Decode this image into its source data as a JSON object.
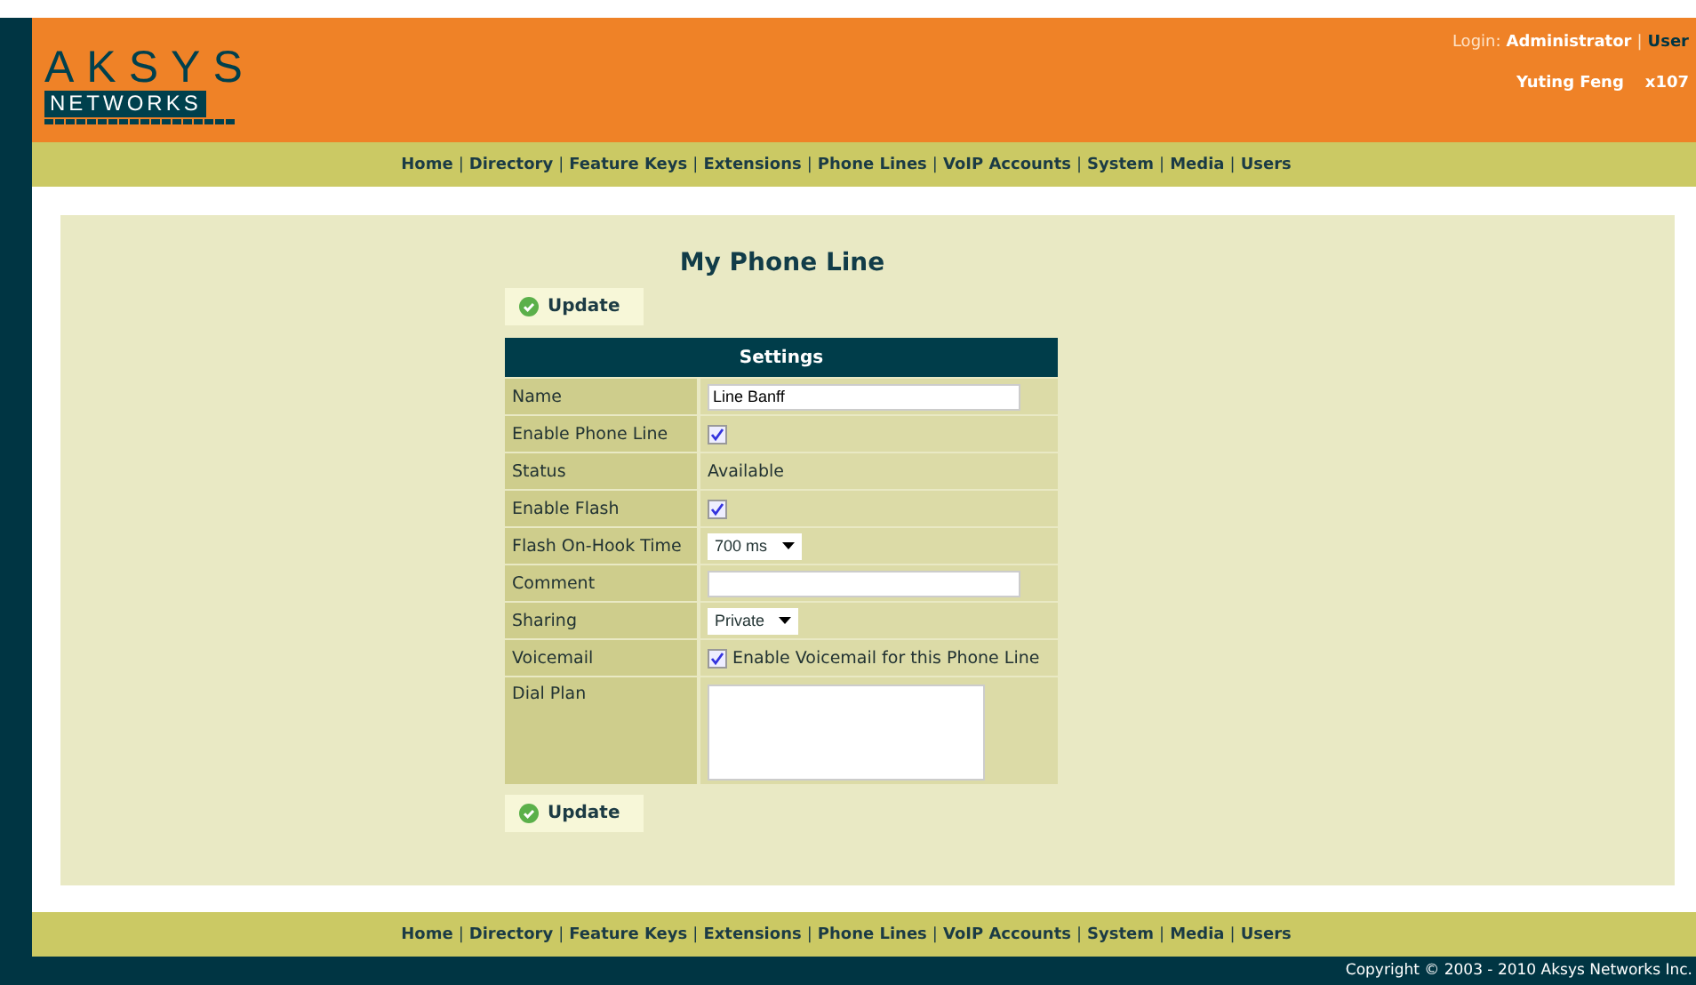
{
  "logo": {
    "top": "AKSYS",
    "bottom": "NETWORKS"
  },
  "login": {
    "label": "Login:",
    "role": "Administrator",
    "separator": "|",
    "link": "User"
  },
  "user": {
    "name": "Yuting Feng",
    "extension": "x107"
  },
  "nav_separator": "|",
  "nav": [
    "Home",
    "Directory",
    "Feature Keys",
    "Extensions",
    "Phone Lines",
    "VoIP Accounts",
    "System",
    "Media",
    "Users"
  ],
  "page_title": "My Phone Line",
  "update_button": "Update",
  "settings": {
    "heading": "Settings",
    "rows": [
      {
        "label": "Name",
        "kind": "text",
        "value": "Line Banff"
      },
      {
        "label": "Enable Phone Line",
        "kind": "checkbox",
        "checked": true
      },
      {
        "label": "Status",
        "kind": "static",
        "value": "Available"
      },
      {
        "label": "Enable Flash",
        "kind": "checkbox",
        "checked": true
      },
      {
        "label": "Flash On-Hook Time",
        "kind": "select",
        "value": "700 ms"
      },
      {
        "label": "Comment",
        "kind": "text",
        "value": ""
      },
      {
        "label": "Sharing",
        "kind": "select",
        "value": "Private"
      },
      {
        "label": "Voicemail",
        "kind": "checkbox",
        "checked": true,
        "text": "Enable Voicemail for this Phone Line"
      },
      {
        "label": "Dial Plan",
        "kind": "textarea"
      }
    ]
  },
  "bottom_button": "Update",
  "footer_nav": [
    "Home",
    "Directory",
    "Feature Keys",
    "Extensions",
    "Phone Lines",
    "VoIP Accounts",
    "System",
    "Media",
    "Users"
  ],
  "copyright": "Copyright © 2003 - 2010 Aksys Networks Inc."
}
